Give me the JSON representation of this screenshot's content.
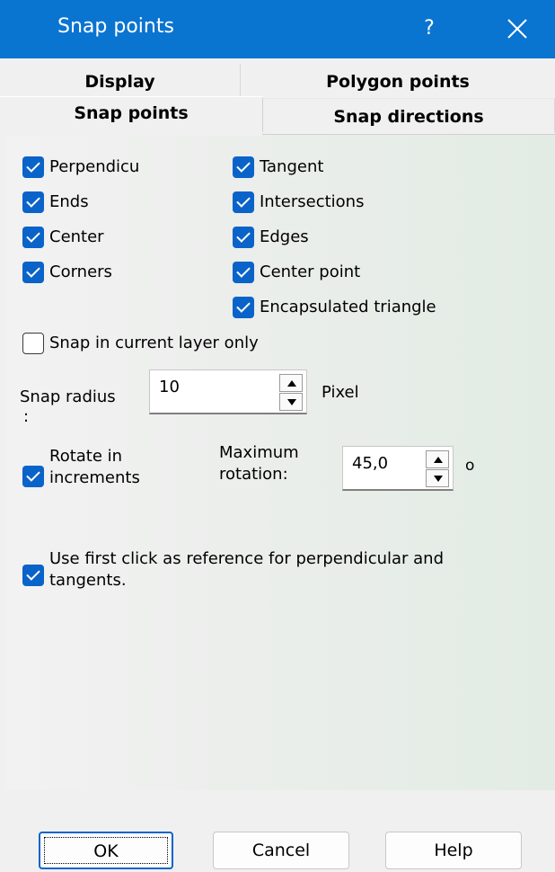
{
  "window": {
    "title": "Snap points",
    "help_glyph": "?",
    "close_icon": "close-icon"
  },
  "tabs": {
    "display": "Display",
    "polygon_points": "Polygon points",
    "snap_points": "Snap points",
    "snap_directions": "Snap directions"
  },
  "checkboxes": {
    "perpendicular": {
      "label": "Perpendicu",
      "checked": true
    },
    "ends": {
      "label": "Ends",
      "checked": true
    },
    "center": {
      "label": "Center",
      "checked": true
    },
    "corners": {
      "label": "Corners",
      "checked": true
    },
    "tangent": {
      "label": "Tangent",
      "checked": true
    },
    "intersections": {
      "label": "Intersections",
      "checked": true
    },
    "edges": {
      "label": "Edges",
      "checked": true
    },
    "center_point": {
      "label": "Center point",
      "checked": true
    },
    "encapsulated_triangle": {
      "label": "Encapsulated triangle",
      "checked": true
    },
    "snap_current_layer": {
      "label": "Snap in current layer only",
      "checked": false
    },
    "rotate_increments": {
      "label": "Rotate in increments",
      "checked": true
    },
    "first_click_reference": {
      "label": "Use first click as reference for perpendicular and tangents.",
      "checked": true
    }
  },
  "snap_radius": {
    "label": "Snap radius",
    "colon": ":",
    "value": "10",
    "unit": "Pixel"
  },
  "max_rotation": {
    "label": "Maximum rotation:",
    "value": "45,0",
    "unit": "o"
  },
  "buttons": {
    "ok": "OK",
    "cancel": "Cancel",
    "help": "Help"
  },
  "colors": {
    "title_bar": "#0a74d1",
    "check_fill": "#0a63c9"
  }
}
